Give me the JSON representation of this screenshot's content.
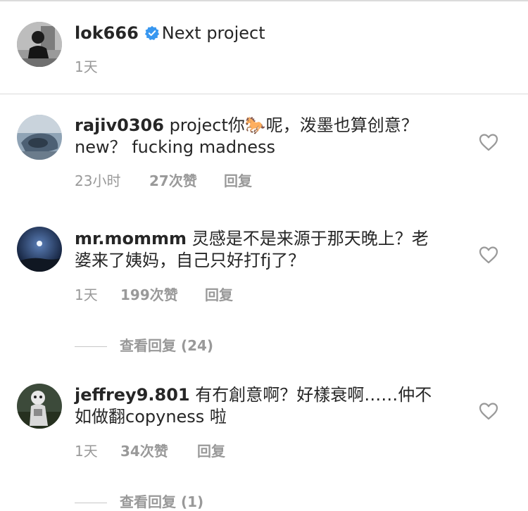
{
  "post": {
    "username": "lok666",
    "caption": "Next project",
    "time": "1天"
  },
  "comments": [
    {
      "username": "rajiv0306",
      "text_line1": " project你🐎呢，泼墨也算创意？",
      "text_line2": "new？ fucking madness",
      "time": "23小时",
      "likes": "27次赞",
      "reply": "回复"
    },
    {
      "username": "mr.mommm",
      "text_line1": " 灵感是不是来源于那天晚上？老",
      "text_line2": "婆来了姨妈，自己只好打fj了？",
      "time": "1天",
      "likes": "199次赞",
      "reply": "回复",
      "view_replies": "查看回复 (24)"
    },
    {
      "username": "jeffrey9.801",
      "text_line1": " 有冇創意啊？好樣衰啊……仲不",
      "text_line2": "如做翻copyness 啦",
      "time": "1天",
      "likes": "34次赞",
      "reply": "回复",
      "view_replies": "查看回复 (1)"
    }
  ],
  "icons": {
    "verified": "verified-badge-icon",
    "like": "heart-outline-icon"
  },
  "colors": {
    "verified_blue": "#3897f0",
    "meta_gray": "#999999",
    "text": "#262626"
  }
}
